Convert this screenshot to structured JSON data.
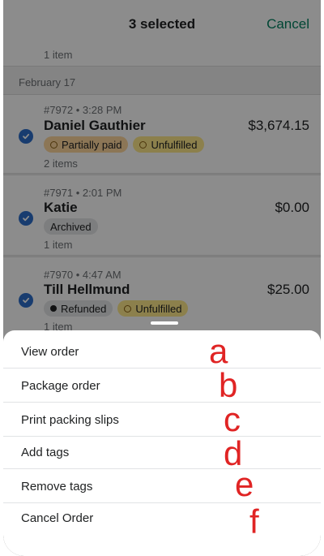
{
  "header": {
    "title": "3 selected",
    "cancel_label": "Cancel"
  },
  "prev_order": {
    "items": "1 item"
  },
  "date_separator": "February 17",
  "orders": [
    {
      "meta": "#7972 • 3:28 PM",
      "name": "Daniel Gauthier",
      "amount": "$3,674.15",
      "badges": [
        "Partially paid",
        "Unfulfilled"
      ],
      "items": "2 items",
      "selected": true
    },
    {
      "meta": "#7971 • 2:01 PM",
      "name": "Katie",
      "amount": "$0.00",
      "badges": [
        "Archived"
      ],
      "items": "1 item",
      "selected": true
    },
    {
      "meta": "#7970 • 4:47 AM",
      "name": "Till Hellmund",
      "amount": "$25.00",
      "badges": [
        "Refunded",
        "Unfulfilled"
      ],
      "items": "1 item",
      "selected": true
    }
  ],
  "actions": [
    {
      "label": "View order",
      "marker": "a"
    },
    {
      "label": "Package order",
      "marker": "b"
    },
    {
      "label": "Print packing slips",
      "marker": "c"
    },
    {
      "label": "Add tags",
      "marker": "d"
    },
    {
      "label": "Remove tags",
      "marker": "e"
    },
    {
      "label": "Cancel Order",
      "marker": "f"
    }
  ],
  "colors": {
    "accent": "#008060",
    "check": "#2c6ecb",
    "marker": "#e02424"
  }
}
